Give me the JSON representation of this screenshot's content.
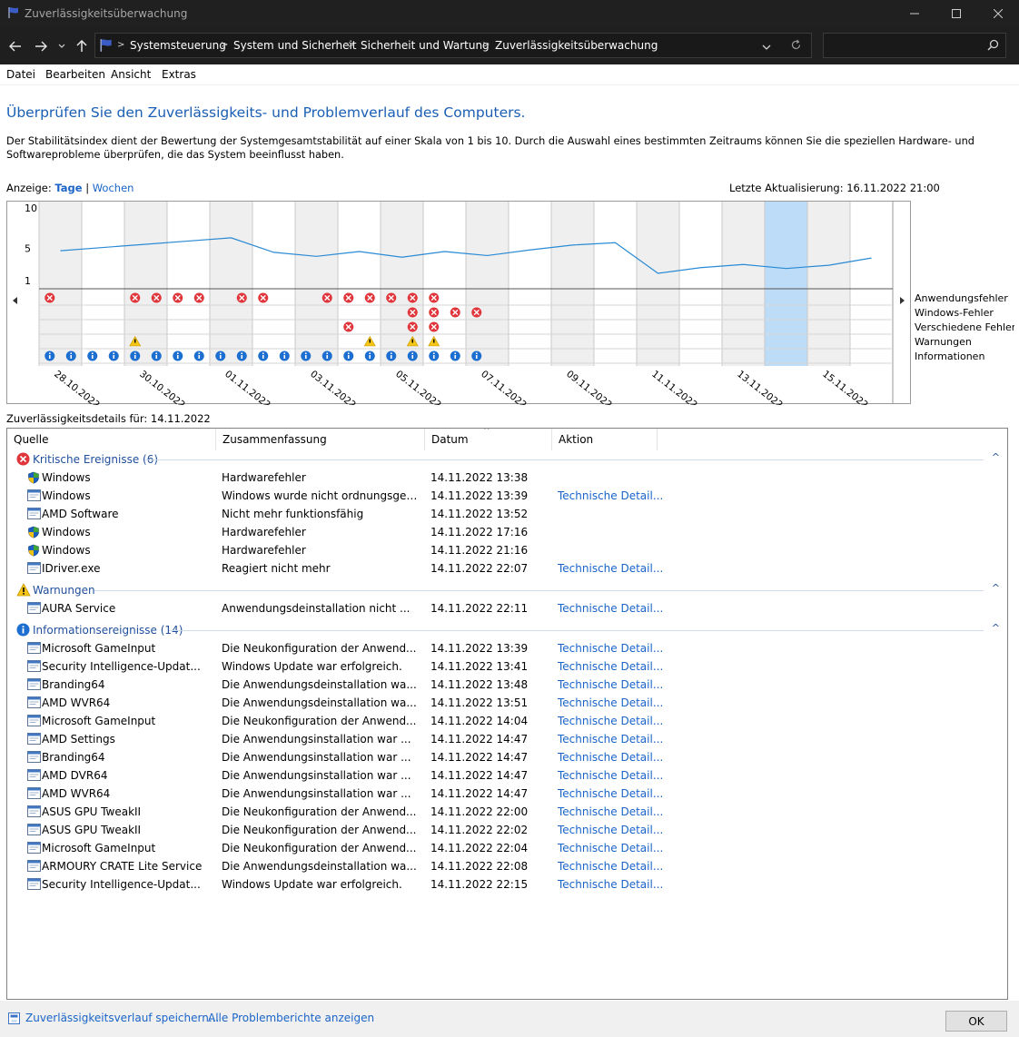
{
  "window": {
    "title": "Zuverlässigkeitsüberwachung"
  },
  "address": {
    "breadcrumbs": [
      "Systemsteuerung",
      "System und Sicherheit",
      "Sicherheit und Wartung",
      "Zuverlässigkeitsüberwachung"
    ],
    "search_placeholder": ""
  },
  "menu": [
    "Datei",
    "Bearbeiten",
    "Ansicht",
    "Extras"
  ],
  "heading": "Überprüfen Sie den Zuverlässigkeits- und Problemverlauf des Computers.",
  "description": "Der Stabilitätsindex dient der Bewertung der Systemgesamtstabilität auf einer Skala von 1 bis 10. Durch die Auswahl eines bestimmten Zeitraums können Sie die speziellen Hardware- und Softwareprobleme überprüfen, die das System beeinflusst haben.",
  "view": {
    "prefix": "Anzeige:",
    "days": "Tage",
    "separator": "|",
    "weeks": "Wochen"
  },
  "last_update": "Letzte Aktualisierung: 16.11.2022 21:00",
  "chart_data": {
    "type": "line",
    "title": "",
    "ylim": [
      1,
      10
    ],
    "yticks": [
      "10",
      "5",
      "1"
    ],
    "selected_index": 17,
    "days": [
      "28.10.2022",
      "29.10.2022",
      "30.10.2022",
      "31.10.2022",
      "01.11.2022",
      "02.11.2022",
      "03.11.2022",
      "04.11.2022",
      "05.11.2022",
      "06.11.2022",
      "07.11.2022",
      "08.11.2022",
      "09.11.2022",
      "10.11.2022",
      "11.11.2022",
      "12.11.2022",
      "13.11.2022",
      "14.11.2022",
      "15.11.2022",
      "16.11.2022"
    ],
    "x_tick_labels": [
      "28.10.2022",
      "30.10.2022",
      "01.11.2022",
      "03.11.2022",
      "05.11.2022",
      "07.11.2022",
      "09.11.2022",
      "11.11.2022",
      "13.11.2022",
      "15.11.2022"
    ],
    "stability_index": [
      4.7,
      5.1,
      5.5,
      5.9,
      6.3,
      4.5,
      4.0,
      4.6,
      3.9,
      4.6,
      4.1,
      4.8,
      5.4,
      5.7,
      1.9,
      2.6,
      3.0,
      2.5,
      2.9,
      3.8
    ],
    "event_rows": [
      {
        "name": "Anwendungsfehler",
        "kind": "error",
        "days": [
          0,
          4,
          5,
          6,
          7,
          9,
          10,
          13,
          14,
          15,
          16,
          17,
          18
        ]
      },
      {
        "name": "Windows-Fehler",
        "kind": "error",
        "days": [
          17,
          18,
          19,
          20
        ]
      },
      {
        "name": "Verschiedene Fehler",
        "kind": "error",
        "days": [
          14,
          17,
          18
        ]
      },
      {
        "name": "Warnungen",
        "kind": "warning",
        "days": [
          4,
          15,
          17,
          18
        ]
      },
      {
        "name": "Informationen",
        "kind": "info",
        "days": [
          0,
          1,
          2,
          3,
          4,
          5,
          6,
          7,
          8,
          9,
          10,
          11,
          12,
          13,
          14,
          15,
          16,
          17,
          18,
          19,
          20
        ]
      }
    ]
  },
  "details_label": "Zuverlässigkeitsdetails für: 14.11.2022",
  "columns": {
    "source": "Quelle",
    "summary": "Zusammenfassung",
    "date": "Datum",
    "action": "Aktion"
  },
  "groups": {
    "critical": {
      "label": "Kritische Ereignisse (6)",
      "rows": [
        {
          "source": "Windows",
          "summary": "Hardwarefehler",
          "date": "14.11.2022 13:38",
          "action": "",
          "icon": "shield"
        },
        {
          "source": "Windows",
          "summary": "Windows wurde nicht ordnungsgemäß heruntergefahren.",
          "date": "14.11.2022 13:39",
          "action": "Technische Details anzeigen",
          "icon": "window"
        },
        {
          "source": "AMD Software",
          "summary": "Nicht mehr funktionsfähig",
          "date": "14.11.2022 13:52",
          "action": "",
          "icon": "window"
        },
        {
          "source": "Windows",
          "summary": "Hardwarefehler",
          "date": "14.11.2022 17:16",
          "action": "",
          "icon": "shield"
        },
        {
          "source": "Windows",
          "summary": "Hardwarefehler",
          "date": "14.11.2022 21:16",
          "action": "",
          "icon": "shield"
        },
        {
          "source": "IDriver.exe",
          "summary": "Reagiert nicht mehr",
          "date": "14.11.2022 22:07",
          "action": "Technische Details anzeigen",
          "icon": "window"
        }
      ]
    },
    "warnings": {
      "label": "Warnungen",
      "rows": [
        {
          "source": "AURA Service",
          "summary": "Anwendungsdeinstallation nicht erfolgreich",
          "date": "14.11.2022 22:11",
          "action": "Technische Details anzeigen",
          "icon": "window"
        }
      ]
    },
    "info": {
      "label": "Informationsereignisse (14)",
      "rows": [
        {
          "source": "Microsoft GameInput",
          "summary": "Die Neukonfiguration der Anwendung war erfolgreich.",
          "date": "14.11.2022 13:39",
          "action": "Technische Details anzeigen",
          "icon": "window"
        },
        {
          "source": "Security Intelligence-Update für Microsoft Defender",
          "summary": "Windows Update war erfolgreich.",
          "date": "14.11.2022 13:41",
          "action": "Technische Details anzeigen",
          "icon": "window"
        },
        {
          "source": "Branding64",
          "summary": "Die Anwendungsdeinstallation war erfolgreich.",
          "date": "14.11.2022 13:48",
          "action": "Technische Details anzeigen",
          "icon": "window"
        },
        {
          "source": "AMD WVR64",
          "summary": "Die Anwendungsdeinstallation war erfolgreich.",
          "date": "14.11.2022 13:51",
          "action": "Technische Details anzeigen",
          "icon": "window"
        },
        {
          "source": "Microsoft GameInput",
          "summary": "Die Neukonfiguration der Anwendung war erfolgreich.",
          "date": "14.11.2022 14:04",
          "action": "Technische Details anzeigen",
          "icon": "window"
        },
        {
          "source": "AMD Settings",
          "summary": "Die Anwendungsinstallation war erfolgreich.",
          "date": "14.11.2022 14:47",
          "action": "Technische Details anzeigen",
          "icon": "window"
        },
        {
          "source": "Branding64",
          "summary": "Die Anwendungsinstallation war erfolgreich.",
          "date": "14.11.2022 14:47",
          "action": "Technische Details anzeigen",
          "icon": "window"
        },
        {
          "source": "AMD DVR64",
          "summary": "Die Anwendungsinstallation war erfolgreich.",
          "date": "14.11.2022 14:47",
          "action": "Technische Details anzeigen",
          "icon": "window"
        },
        {
          "source": "AMD WVR64",
          "summary": "Die Anwendungsinstallation war erfolgreich.",
          "date": "14.11.2022 14:47",
          "action": "Technische Details anzeigen",
          "icon": "window"
        },
        {
          "source": "ASUS GPU TweakII",
          "summary": "Die Neukonfiguration der Anwendung war erfolgreich.",
          "date": "14.11.2022 22:00",
          "action": "Technische Details anzeigen",
          "icon": "window"
        },
        {
          "source": "ASUS GPU TweakII",
          "summary": "Die Neukonfiguration der Anwendung war erfolgreich.",
          "date": "14.11.2022 22:02",
          "action": "Technische Details anzeigen",
          "icon": "window"
        },
        {
          "source": "Microsoft GameInput",
          "summary": "Die Neukonfiguration der Anwendung war erfolgreich.",
          "date": "14.11.2022 22:04",
          "action": "Technische Details anzeigen",
          "icon": "window"
        },
        {
          "source": "ARMOURY CRATE Lite Service",
          "summary": "Die Anwendungsdeinstallation war erfolgreich.",
          "date": "14.11.2022 22:08",
          "action": "Technische Details anzeigen",
          "icon": "window"
        },
        {
          "source": "Security Intelligence-Update für Microsoft Defender",
          "summary": "Windows Update war erfolgreich.",
          "date": "14.11.2022 22:15",
          "action": "Technische Details anzeigen",
          "icon": "window"
        }
      ]
    }
  },
  "footer": {
    "save_link": "Zuverlässigkeitsverlauf speichern...",
    "reports_link": "Alle Problemberichte anzeigen",
    "ok_label": "OK"
  },
  "colors": {
    "accent_link": "#1a64c8",
    "heading": "#1a5fb4",
    "line": "#2a8ad4",
    "selected_column": "#bcdcf7",
    "error": "#e0353b",
    "warning": "#f5c518",
    "info": "#1c6fd0"
  }
}
